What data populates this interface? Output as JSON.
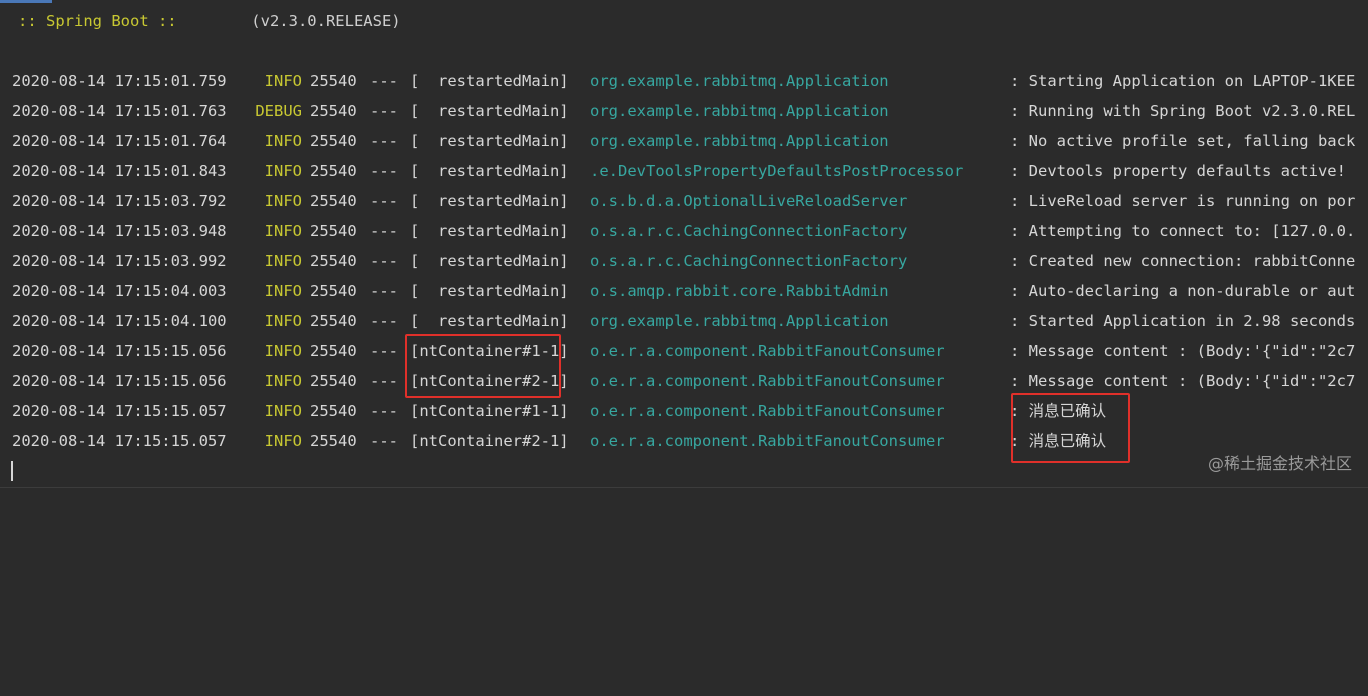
{
  "banner": {
    "label": ":: Spring Boot ::",
    "version": "(v2.3.0.RELEASE)"
  },
  "rows": [
    {
      "ts": "2020-08-14 17:15:01.759",
      "level": "INFO",
      "pid": "25540",
      "sep": "---",
      "thread": "[  restartedMain]",
      "logger": "org.example.rabbitmq.Application",
      "msg": ": Starting Application on LAPTOP-1KEE"
    },
    {
      "ts": "2020-08-14 17:15:01.763",
      "level": "DEBUG",
      "pid": "25540",
      "sep": "---",
      "thread": "[  restartedMain]",
      "logger": "org.example.rabbitmq.Application",
      "msg": ": Running with Spring Boot v2.3.0.REL"
    },
    {
      "ts": "2020-08-14 17:15:01.764",
      "level": "INFO",
      "pid": "25540",
      "sep": "---",
      "thread": "[  restartedMain]",
      "logger": "org.example.rabbitmq.Application",
      "msg": ": No active profile set, falling back"
    },
    {
      "ts": "2020-08-14 17:15:01.843",
      "level": "INFO",
      "pid": "25540",
      "sep": "---",
      "thread": "[  restartedMain]",
      "logger": ".e.DevToolsPropertyDefaultsPostProcessor",
      "msg": ": Devtools property defaults active!"
    },
    {
      "ts": "2020-08-14 17:15:03.792",
      "level": "INFO",
      "pid": "25540",
      "sep": "---",
      "thread": "[  restartedMain]",
      "logger": "o.s.b.d.a.OptionalLiveReloadServer",
      "msg": ": LiveReload server is running on por"
    },
    {
      "ts": "2020-08-14 17:15:03.948",
      "level": "INFO",
      "pid": "25540",
      "sep": "---",
      "thread": "[  restartedMain]",
      "logger": "o.s.a.r.c.CachingConnectionFactory",
      "msg": ": Attempting to connect to: [127.0.0."
    },
    {
      "ts": "2020-08-14 17:15:03.992",
      "level": "INFO",
      "pid": "25540",
      "sep": "---",
      "thread": "[  restartedMain]",
      "logger": "o.s.a.r.c.CachingConnectionFactory",
      "msg": ": Created new connection: rabbitConne"
    },
    {
      "ts": "2020-08-14 17:15:04.003",
      "level": "INFO",
      "pid": "25540",
      "sep": "---",
      "thread": "[  restartedMain]",
      "logger": "o.s.amqp.rabbit.core.RabbitAdmin",
      "msg": ": Auto-declaring a non-durable or aut"
    },
    {
      "ts": "2020-08-14 17:15:04.100",
      "level": "INFO",
      "pid": "25540",
      "sep": "---",
      "thread": "[  restartedMain]",
      "logger": "org.example.rabbitmq.Application",
      "msg": ": Started Application in 2.98 seconds"
    },
    {
      "ts": "2020-08-14 17:15:15.056",
      "level": "INFO",
      "pid": "25540",
      "sep": "---",
      "thread": "[ntContainer#1-1]",
      "logger": "o.e.r.a.component.RabbitFanoutConsumer",
      "msg": ": Message content : (Body:'{\"id\":\"2c7"
    },
    {
      "ts": "2020-08-14 17:15:15.056",
      "level": "INFO",
      "pid": "25540",
      "sep": "---",
      "thread": "[ntContainer#2-1]",
      "logger": "o.e.r.a.component.RabbitFanoutConsumer",
      "msg": ": Message content : (Body:'{\"id\":\"2c7"
    },
    {
      "ts": "2020-08-14 17:15:15.057",
      "level": "INFO",
      "pid": "25540",
      "sep": "---",
      "thread": "[ntContainer#1-1]",
      "logger": "o.e.r.a.component.RabbitFanoutConsumer",
      "msg": ": 消息已确认"
    },
    {
      "ts": "2020-08-14 17:15:15.057",
      "level": "INFO",
      "pid": "25540",
      "sep": "---",
      "thread": "[ntContainer#2-1]",
      "logger": "o.e.r.a.component.RabbitFanoutConsumer",
      "msg": ": 消息已确认"
    }
  ],
  "watermark": "@稀土掘金技术社区",
  "colors": {
    "background": "#2b2b2b",
    "level": "#c8c832",
    "logger": "#37a7a0",
    "highlight": "#e0302a"
  }
}
